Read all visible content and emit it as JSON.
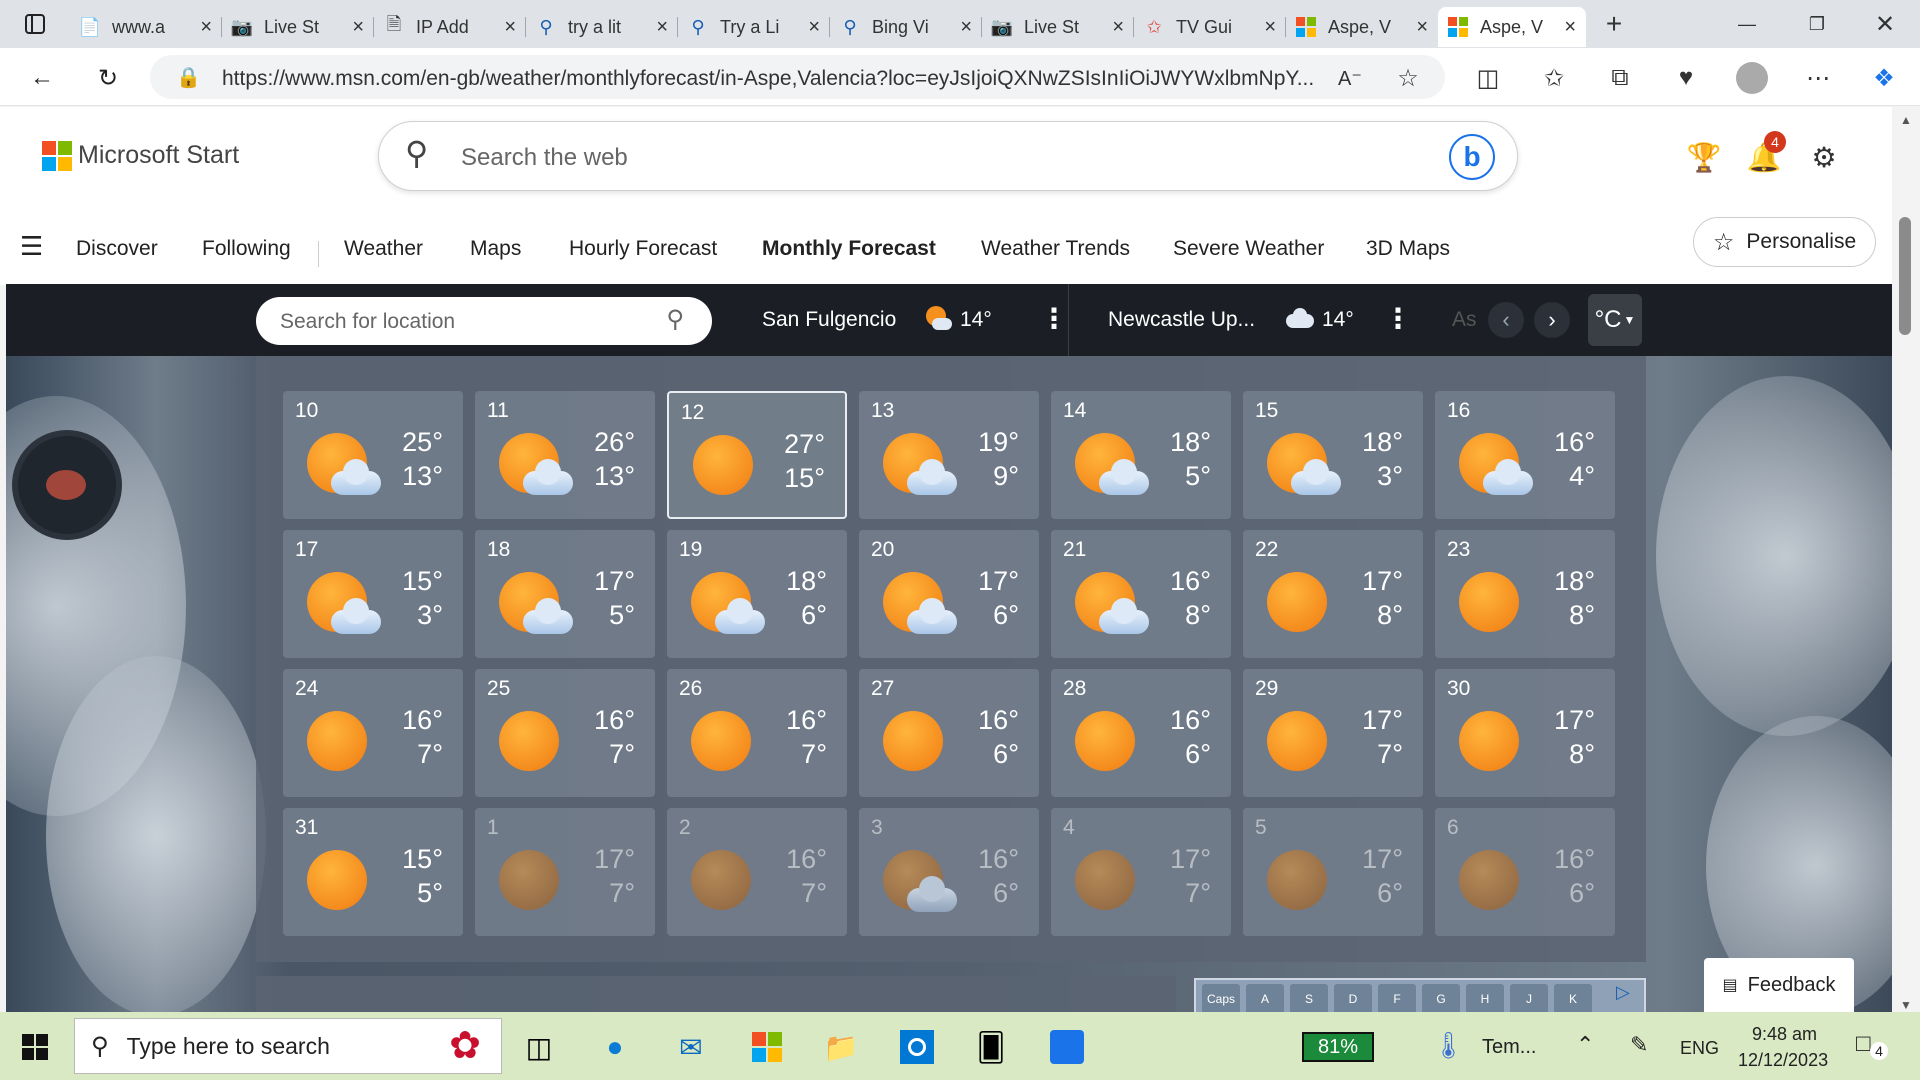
{
  "browser": {
    "tabs": [
      {
        "title": "www.a",
        "icon": "document-icon"
      },
      {
        "title": "Live St",
        "icon": "live-icon"
      },
      {
        "title": "IP Add",
        "icon": "page-icon"
      },
      {
        "title": "try a lit",
        "icon": "search-icon"
      },
      {
        "title": "Try a Li",
        "icon": "search-icon"
      },
      {
        "title": "Bing Vi",
        "icon": "search-icon"
      },
      {
        "title": "Live St",
        "icon": "live-icon"
      },
      {
        "title": "TV Gui",
        "icon": "tv-icon"
      },
      {
        "title": "Aspe, V",
        "icon": "msn-icon"
      },
      {
        "title": "Aspe, V",
        "icon": "msn-icon"
      }
    ],
    "url": "https://www.msn.com/en-gb/weather/monthlyforecast/in-Aspe,Valencia?loc=eyJsIjoiQXNwZSIsInIiOiJWYWxlbmNpY..."
  },
  "msn": {
    "brand": "Microsoft Start",
    "search_placeholder": "Search the web",
    "notifications_badge": "4",
    "nav": [
      "Discover",
      "Following",
      "Weather",
      "Maps",
      "Hourly Forecast",
      "Monthly Forecast",
      "Weather Trends",
      "Severe Weather",
      "3D Maps"
    ],
    "personalise": "Personalise"
  },
  "weather": {
    "location_placeholder": "Search for location",
    "saved_locations": [
      {
        "name": "San Fulgencio",
        "temp": "14°"
      },
      {
        "name": "Newcastle Up...",
        "temp": "14°"
      },
      {
        "name": "As",
        "temp": ""
      }
    ],
    "unit": "°C",
    "days": [
      {
        "d": "10",
        "hi": "25°",
        "lo": "13°",
        "icon": "sun-cloud",
        "dim": false,
        "today": false
      },
      {
        "d": "11",
        "hi": "26°",
        "lo": "13°",
        "icon": "sun-cloud",
        "dim": false,
        "today": false
      },
      {
        "d": "12",
        "hi": "27°",
        "lo": "15°",
        "icon": "sun",
        "dim": false,
        "today": true
      },
      {
        "d": "13",
        "hi": "19°",
        "lo": "9°",
        "icon": "sun-cloud",
        "dim": false,
        "today": false
      },
      {
        "d": "14",
        "hi": "18°",
        "lo": "5°",
        "icon": "sun-cloud",
        "dim": false,
        "today": false
      },
      {
        "d": "15",
        "hi": "18°",
        "lo": "3°",
        "icon": "sun-cloud",
        "dim": false,
        "today": false
      },
      {
        "d": "16",
        "hi": "16°",
        "lo": "4°",
        "icon": "sun-cloud",
        "dim": false,
        "today": false
      },
      {
        "d": "17",
        "hi": "15°",
        "lo": "3°",
        "icon": "sun-cloud",
        "dim": false,
        "today": false
      },
      {
        "d": "18",
        "hi": "17°",
        "lo": "5°",
        "icon": "sun-cloud",
        "dim": false,
        "today": false
      },
      {
        "d": "19",
        "hi": "18°",
        "lo": "6°",
        "icon": "sun-cloud",
        "dim": false,
        "today": false
      },
      {
        "d": "20",
        "hi": "17°",
        "lo": "6°",
        "icon": "sun-cloud",
        "dim": false,
        "today": false
      },
      {
        "d": "21",
        "hi": "16°",
        "lo": "8°",
        "icon": "sun-cloud",
        "dim": false,
        "today": false
      },
      {
        "d": "22",
        "hi": "17°",
        "lo": "8°",
        "icon": "sun",
        "dim": false,
        "today": false
      },
      {
        "d": "23",
        "hi": "18°",
        "lo": "8°",
        "icon": "sun",
        "dim": false,
        "today": false
      },
      {
        "d": "24",
        "hi": "16°",
        "lo": "7°",
        "icon": "sun",
        "dim": false,
        "today": false
      },
      {
        "d": "25",
        "hi": "16°",
        "lo": "7°",
        "icon": "sun",
        "dim": false,
        "today": false
      },
      {
        "d": "26",
        "hi": "16°",
        "lo": "7°",
        "icon": "sun",
        "dim": false,
        "today": false
      },
      {
        "d": "27",
        "hi": "16°",
        "lo": "6°",
        "icon": "sun",
        "dim": false,
        "today": false
      },
      {
        "d": "28",
        "hi": "16°",
        "lo": "6°",
        "icon": "sun",
        "dim": false,
        "today": false
      },
      {
        "d": "29",
        "hi": "17°",
        "lo": "7°",
        "icon": "sun",
        "dim": false,
        "today": false
      },
      {
        "d": "30",
        "hi": "17°",
        "lo": "8°",
        "icon": "sun",
        "dim": false,
        "today": false
      },
      {
        "d": "31",
        "hi": "15°",
        "lo": "5°",
        "icon": "sun",
        "dim": false,
        "today": false
      },
      {
        "d": "1",
        "hi": "17°",
        "lo": "7°",
        "icon": "sun",
        "dim": true,
        "today": false
      },
      {
        "d": "2",
        "hi": "16°",
        "lo": "7°",
        "icon": "sun",
        "dim": true,
        "today": false
      },
      {
        "d": "3",
        "hi": "16°",
        "lo": "6°",
        "icon": "sun-cloud",
        "dim": true,
        "today": false
      },
      {
        "d": "4",
        "hi": "17°",
        "lo": "7°",
        "icon": "sun",
        "dim": true,
        "today": false
      },
      {
        "d": "5",
        "hi": "17°",
        "lo": "6°",
        "icon": "sun",
        "dim": true,
        "today": false
      },
      {
        "d": "6",
        "hi": "16°",
        "lo": "6°",
        "icon": "sun",
        "dim": true,
        "today": false
      }
    ],
    "feedback": "Feedback",
    "keyboard_keys": [
      "Caps",
      "A",
      "S",
      "D",
      "F",
      "G",
      "H",
      "J",
      "K"
    ]
  },
  "taskbar": {
    "search_placeholder": "Type here to search",
    "battery": "81%",
    "weather_label": "Tem...",
    "language": "ENG",
    "time": "9:48 am",
    "date": "12/12/2023",
    "notification_count": "4"
  },
  "colors": {
    "sun": "#f5901e",
    "dark_bar": "#1b1f25",
    "taskbar": "#d8e9c4",
    "battery": "#1b8a3a"
  }
}
